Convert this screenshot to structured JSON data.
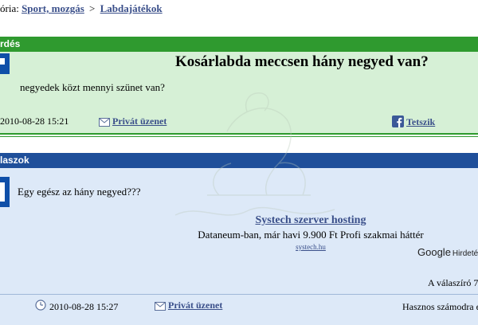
{
  "breadcrumb": {
    "prefix": "ória:",
    "category": "Sport, mozgás",
    "separator": ">",
    "subcategory": "Labdajátékok"
  },
  "question": {
    "header": "rdés",
    "title": "Kosárlabda meccsen hány negyed van?",
    "body": "negyedek közt mennyi szünet van?",
    "date": "2010-08-28 15:21",
    "private_message": "Privát üzenet",
    "like": "Tetszik"
  },
  "answers": {
    "header": "laszok",
    "body": "Egy egész az hány negyed???",
    "ad": {
      "title": "Systech szerver hosting",
      "description": "Dataneum-ban, már havi 9.900 Ft Profi szakmai háttér",
      "url": "systech.hu",
      "google": "Google",
      "hirdetes": "Hirdeté"
    },
    "responder_label": "A válaszíró 7",
    "date": "2010-08-28 15:27",
    "private_message": "Privát üzenet",
    "useful_label": "Hasznos számodra e"
  },
  "colors": {
    "green_bar": "#2f9a2f",
    "green_bg": "#d6f0d6",
    "blue_bar": "#1f4f9a",
    "blue_bg": "#dde9f8",
    "link": "#3a4f8a"
  },
  "icons": {
    "message": "envelope-icon",
    "like": "facebook-icon",
    "clock": "clock-icon"
  }
}
